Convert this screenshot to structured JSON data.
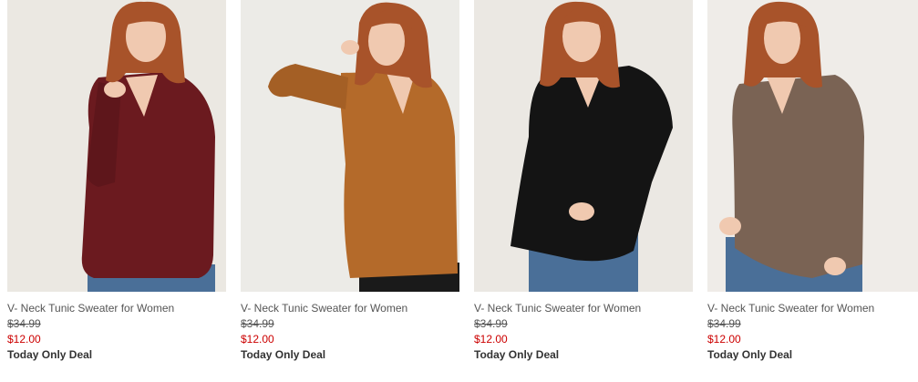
{
  "products": [
    {
      "name": "V- Neck Tunic Sweater for Women",
      "original_price": "$34.99",
      "sale_price": "$12.00",
      "deal_label": "Today Only Deal",
      "sweater_color": "#6b1a1f",
      "background_color": "#ebe8e2"
    },
    {
      "name": "V- Neck Tunic Sweater for Women",
      "original_price": "$34.99",
      "sale_price": "$12.00",
      "deal_label": "Today Only Deal",
      "sweater_color": "#b46a2a",
      "background_color": "#ecebe7"
    },
    {
      "name": "V- Neck Tunic Sweater for Women",
      "original_price": "$34.99",
      "sale_price": "$12.00",
      "deal_label": "Today Only Deal",
      "sweater_color": "#141414",
      "background_color": "#ebe8e3"
    },
    {
      "name": "V- Neck Tunic Sweater for Women",
      "original_price": "$34.99",
      "sale_price": "$12.00",
      "deal_label": "Today Only Deal",
      "sweater_color": "#7a6354",
      "background_color": "#efece8"
    }
  ],
  "colors": {
    "sale_price": "#cc0000",
    "text": "#555555",
    "hair": "#a8532a",
    "skin": "#f0c9b0",
    "jeans": "#4a6f98"
  }
}
